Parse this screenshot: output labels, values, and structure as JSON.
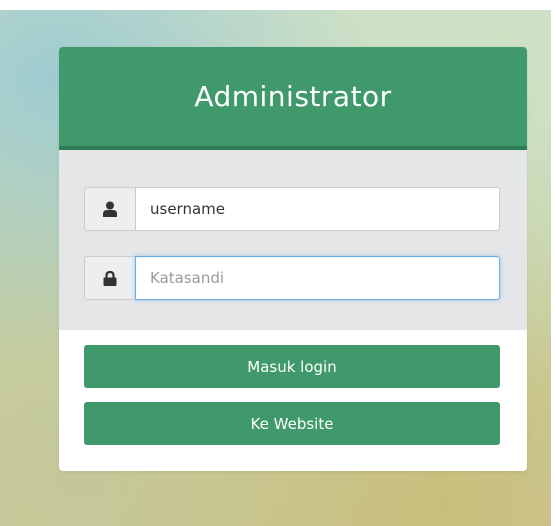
{
  "login_card": {
    "title": "Administrator",
    "username_field": {
      "value": "username",
      "icon": "user-icon"
    },
    "password_field": {
      "placeholder": "Katasandi",
      "value": "",
      "icon": "lock-icon"
    },
    "buttons": {
      "login_label": "Masuk login",
      "website_label": "Ke Website"
    }
  },
  "colors": {
    "primary_green": "#40996b",
    "header_border": "#2f7d55",
    "form_background": "#e5e6e8",
    "focus_border": "#66afe9"
  }
}
